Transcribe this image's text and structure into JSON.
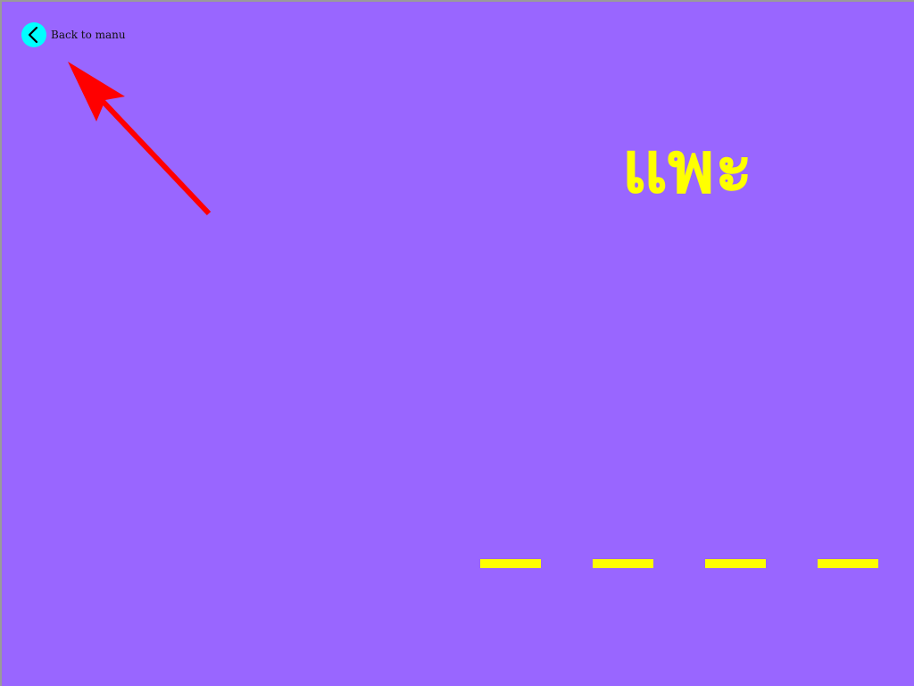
{
  "colors": {
    "background": "#9966ff",
    "accent_yellow": "#ffff00",
    "back_circle": "#00ffff",
    "arrow_red": "#ff0000"
  },
  "nav": {
    "back_label": "Back to manu",
    "back_icon": "chevron-left-icon"
  },
  "annotation": {
    "arrow_icon": "red-arrow-icon"
  },
  "game": {
    "word": "แพะ",
    "blanks": [
      "",
      "",
      "",
      ""
    ]
  }
}
